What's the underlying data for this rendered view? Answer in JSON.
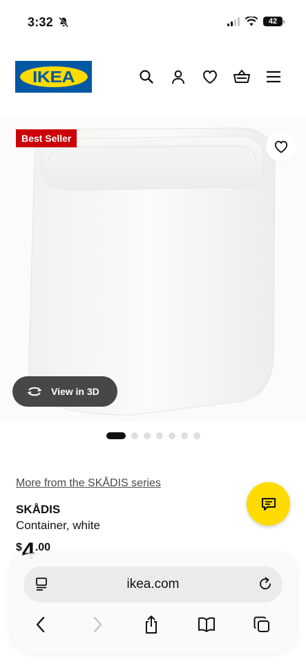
{
  "status_bar": {
    "time": "3:32",
    "battery": "42"
  },
  "header": {
    "logo_text": "IKEA",
    "icons": [
      "search-icon",
      "profile-icon",
      "heart-icon",
      "shopping-basket-icon",
      "menu-icon"
    ]
  },
  "product_media": {
    "badge": "Best Seller",
    "view_3d_label": "View in 3D",
    "carousel": {
      "total": 7,
      "active": 1
    }
  },
  "product": {
    "series_link": "More from the SKÅDIS series",
    "name": "SKÅDIS",
    "description": "Container, white",
    "price_currency": "$",
    "price_integer": "4",
    "price_decimal": ".00"
  },
  "browser": {
    "url": "ikea.com"
  },
  "colors": {
    "ikea_blue": "#0058a3",
    "ikea_yellow": "#ffdb00",
    "badge_red": "#cc0008",
    "pill_dark": "#474747"
  }
}
